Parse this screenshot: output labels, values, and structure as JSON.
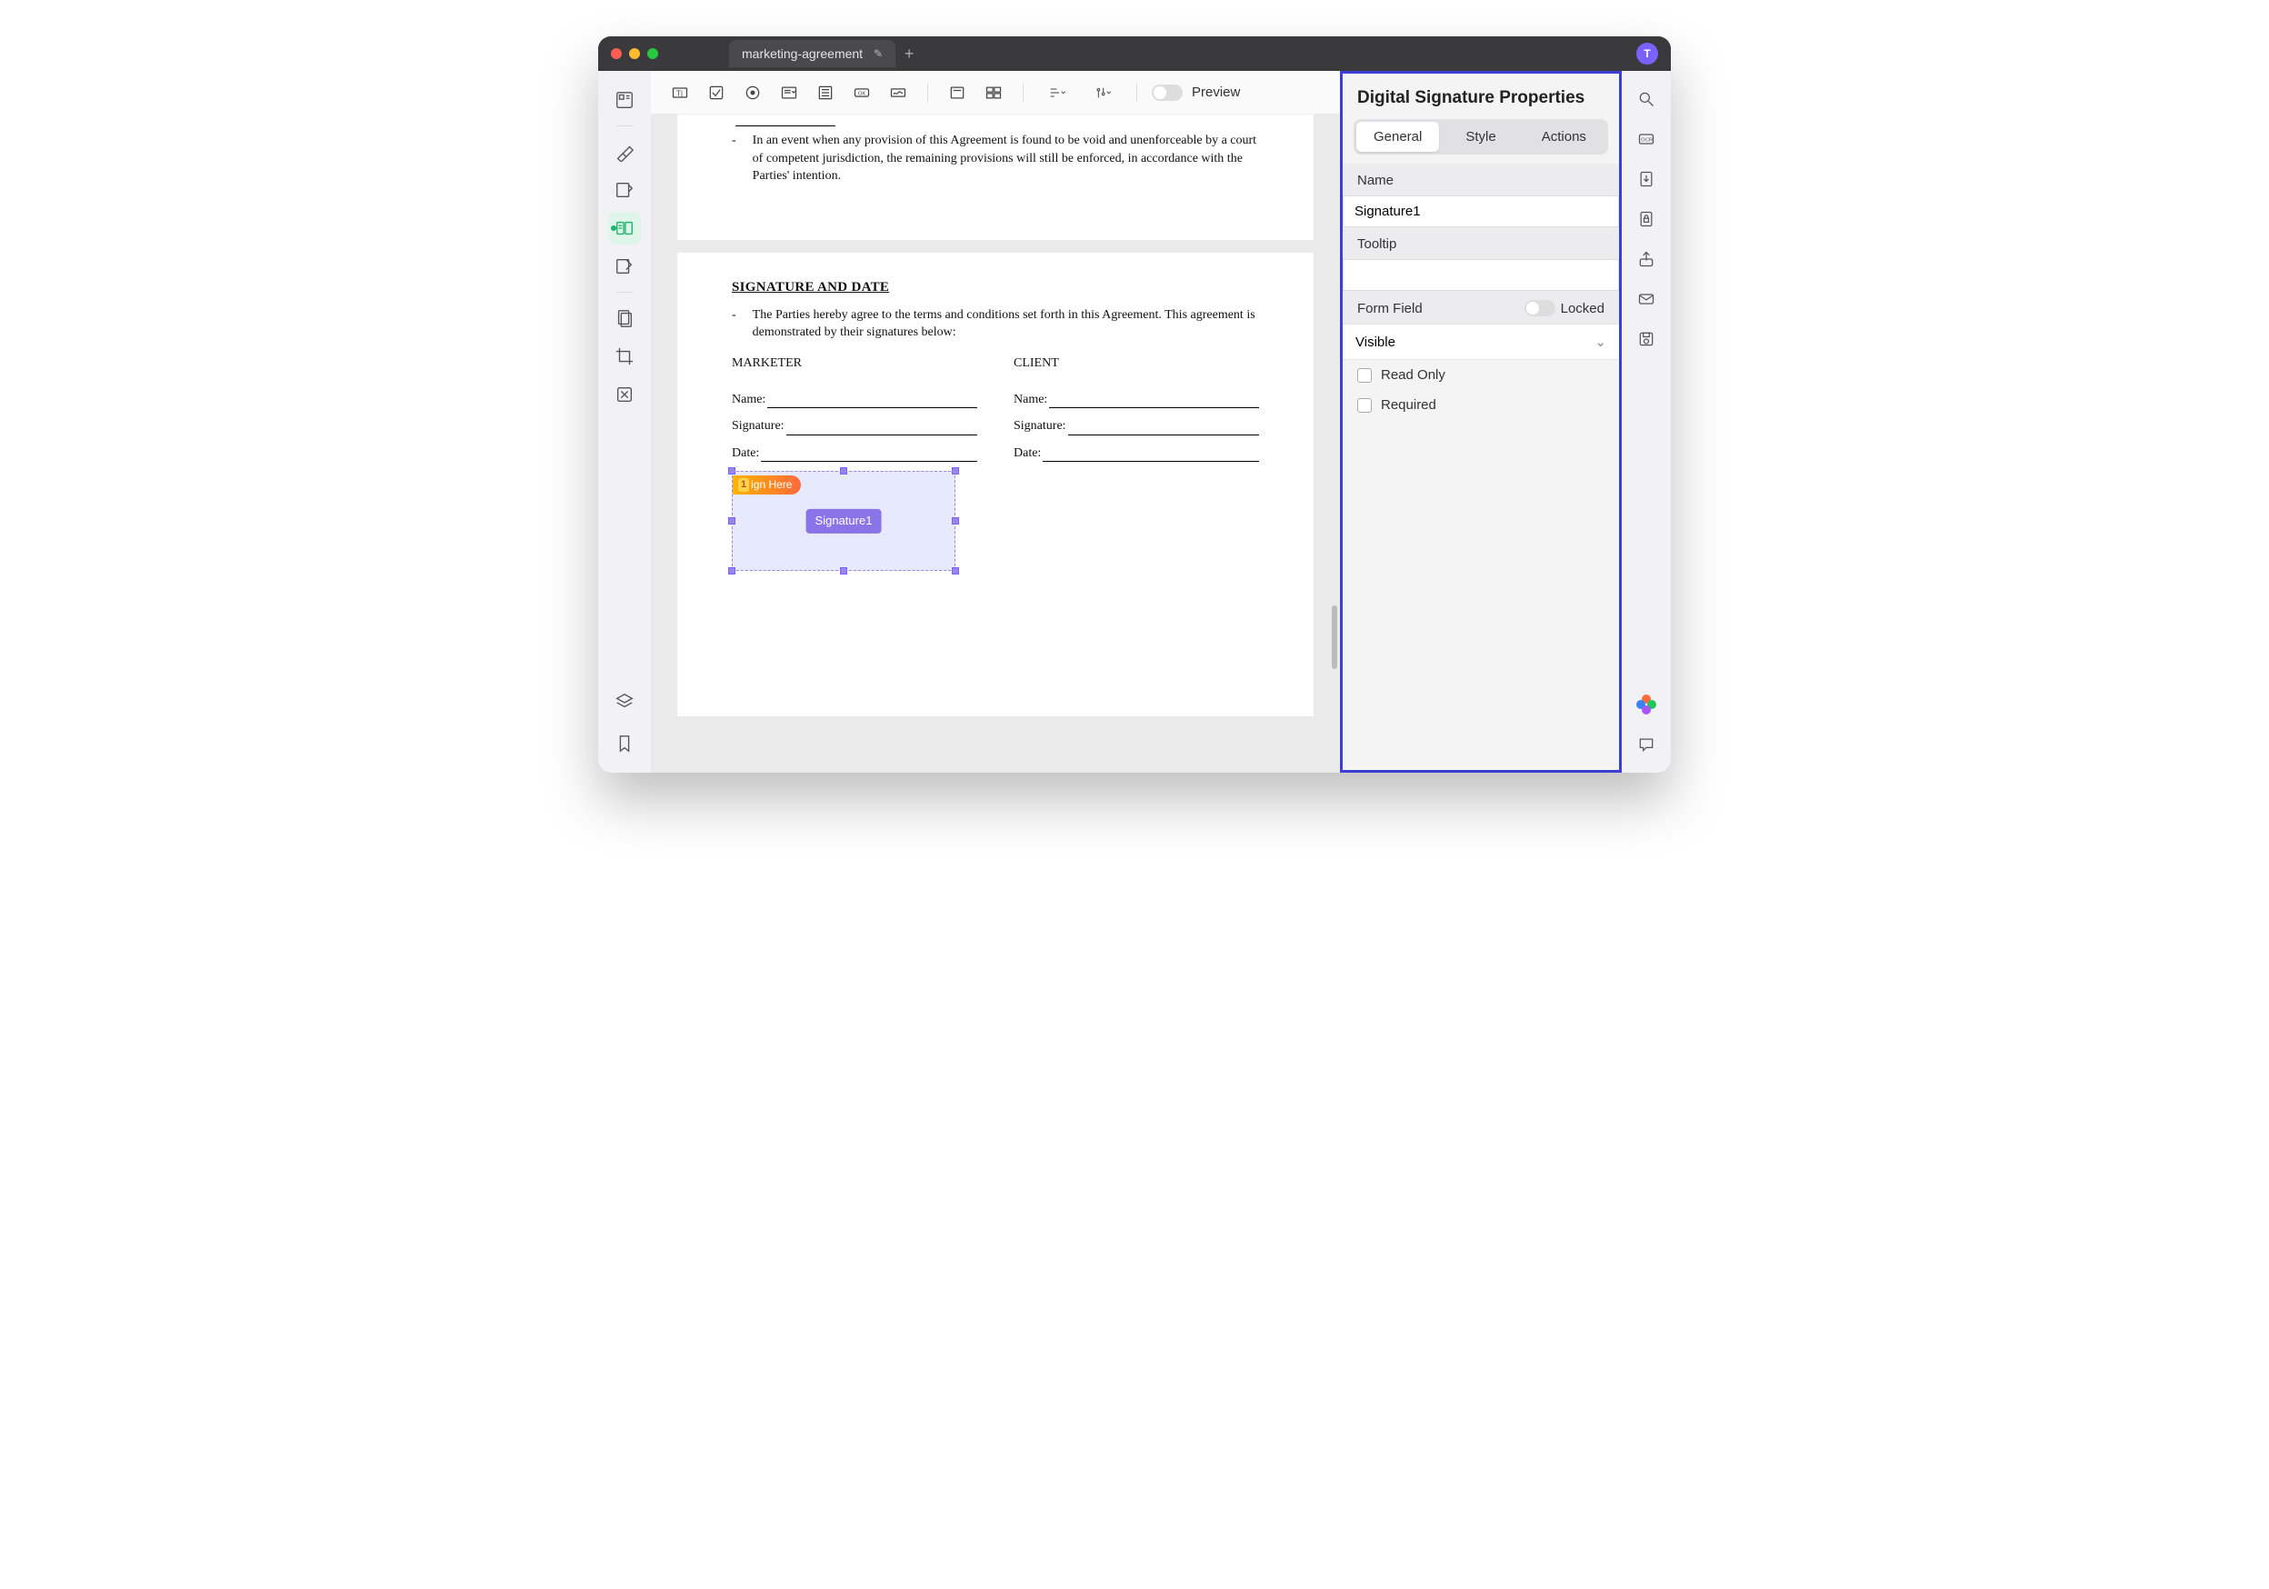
{
  "titlebar": {
    "tab_title": "marketing-agreement",
    "avatar_letter": "T"
  },
  "toolbar": {
    "preview_label": "Preview"
  },
  "document": {
    "fragment1_text": "In an event when any provision of this Agreement is found to be void and unenforceable by a court of competent jurisdiction, the remaining provisions will still be enforced, in accordance with the Parties' intention.",
    "sig_heading": "SIGNATURE AND DATE",
    "sig_intro": "The Parties hereby agree to the terms and conditions set forth in this Agreement. This agreement is demonstrated by their signatures below:",
    "col1_header": "MARKETER",
    "col2_header": "CLIENT",
    "row_name": "Name:",
    "row_signature": "Signature:",
    "row_date": "Date:",
    "sign_here_badge_num": "1",
    "sign_here_badge_text": "ign Here",
    "signature_chip": "Signature1"
  },
  "props": {
    "panel_title": "Digital Signature Properties",
    "tabs": {
      "general": "General",
      "style": "Style",
      "actions": "Actions"
    },
    "name_label": "Name",
    "name_value": "Signature1",
    "tooltip_label": "Tooltip",
    "tooltip_value": "",
    "formfield_label": "Form Field",
    "locked_label": "Locked",
    "visibility_value": "Visible",
    "readonly_label": "Read Only",
    "required_label": "Required"
  }
}
